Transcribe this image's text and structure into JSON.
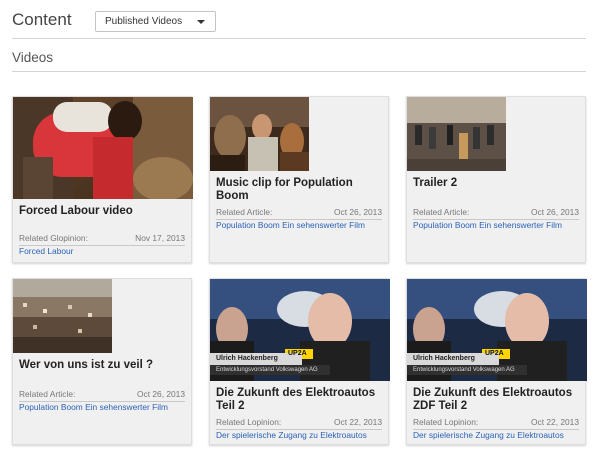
{
  "header": {
    "title": "Content",
    "filter_selected": "Published Videos"
  },
  "section": {
    "title": "Videos"
  },
  "cards": [
    {
      "title": "Forced Labour video",
      "meta_label": "Related Glopinion:",
      "date": "Nov 17, 2013",
      "link": "Forced Labour"
    },
    {
      "title": "Music clip for Population Boom",
      "meta_label": "Related Article:",
      "date": "Oct 26, 2013",
      "link": "Population Boom Ein sehenswerter Film"
    },
    {
      "title": "Trailer 2",
      "meta_label": "Related Article:",
      "date": "Oct 26, 2013",
      "link": "Population Boom Ein sehenswerter Film"
    },
    {
      "title": "Wer von uns ist zu veil ?",
      "meta_label": "Related Article:",
      "date": "Oct 26, 2013",
      "link": "Population Boom Ein sehenswerter Film"
    },
    {
      "title": "Die Zukunft des Elektroautos Teil 2",
      "meta_label": "Related Lopinion:",
      "date": "Oct 22, 2013",
      "link": "Der spielerische Zugang zu Elektroautos"
    },
    {
      "title": "Die Zukunft des Elektroautos ZDF Teil 2",
      "meta_label": "Related Lopinion:",
      "date": "Oct 22, 2013",
      "link": "Der spielerische Zugang zu Elektroautos"
    }
  ],
  "thumb_overlays": {
    "name": "Ulrich Hackenberg",
    "subtitle": "Entwicklungsvorstand Volkswagen AG",
    "channel": "UP2A"
  }
}
